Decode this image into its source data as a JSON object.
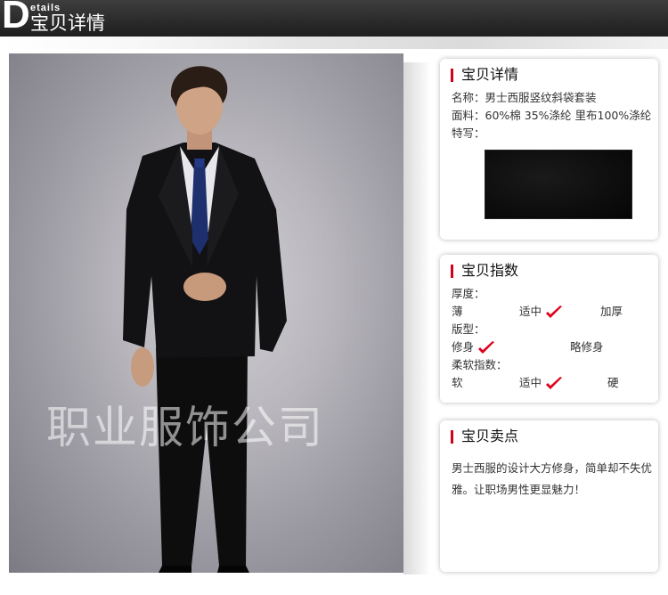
{
  "header": {
    "big_letter": "D",
    "small_word": "etails",
    "title": "宝贝详情"
  },
  "photo": {
    "watermark": "职业服饰公司"
  },
  "details": {
    "title": "宝贝详情",
    "name_line": "名称：男士西服竖纹斜袋套装",
    "fabric_line": "面料：60%棉   35%涤纶 里布100%涤纶",
    "feature_label": "特写："
  },
  "index": {
    "title": "宝贝指数",
    "thickness_label": "厚度：",
    "thickness_options": [
      "薄",
      "适中",
      "加厚"
    ],
    "thickness_selected": "适中",
    "fit_label": "版型：",
    "fit_options": [
      "修身",
      "略修身"
    ],
    "fit_selected": "修身",
    "softness_label": "柔软指数：",
    "softness_options": [
      "软",
      "适中",
      "硬"
    ],
    "softness_selected": "适中"
  },
  "selling": {
    "title": "宝贝卖点",
    "text": "男士西服的设计大方修身，简单却不失优雅。让职场男性更显魅力！"
  },
  "colors": {
    "accent": "#d0021b",
    "check": "#e0001b",
    "header_bg": "#333333"
  }
}
